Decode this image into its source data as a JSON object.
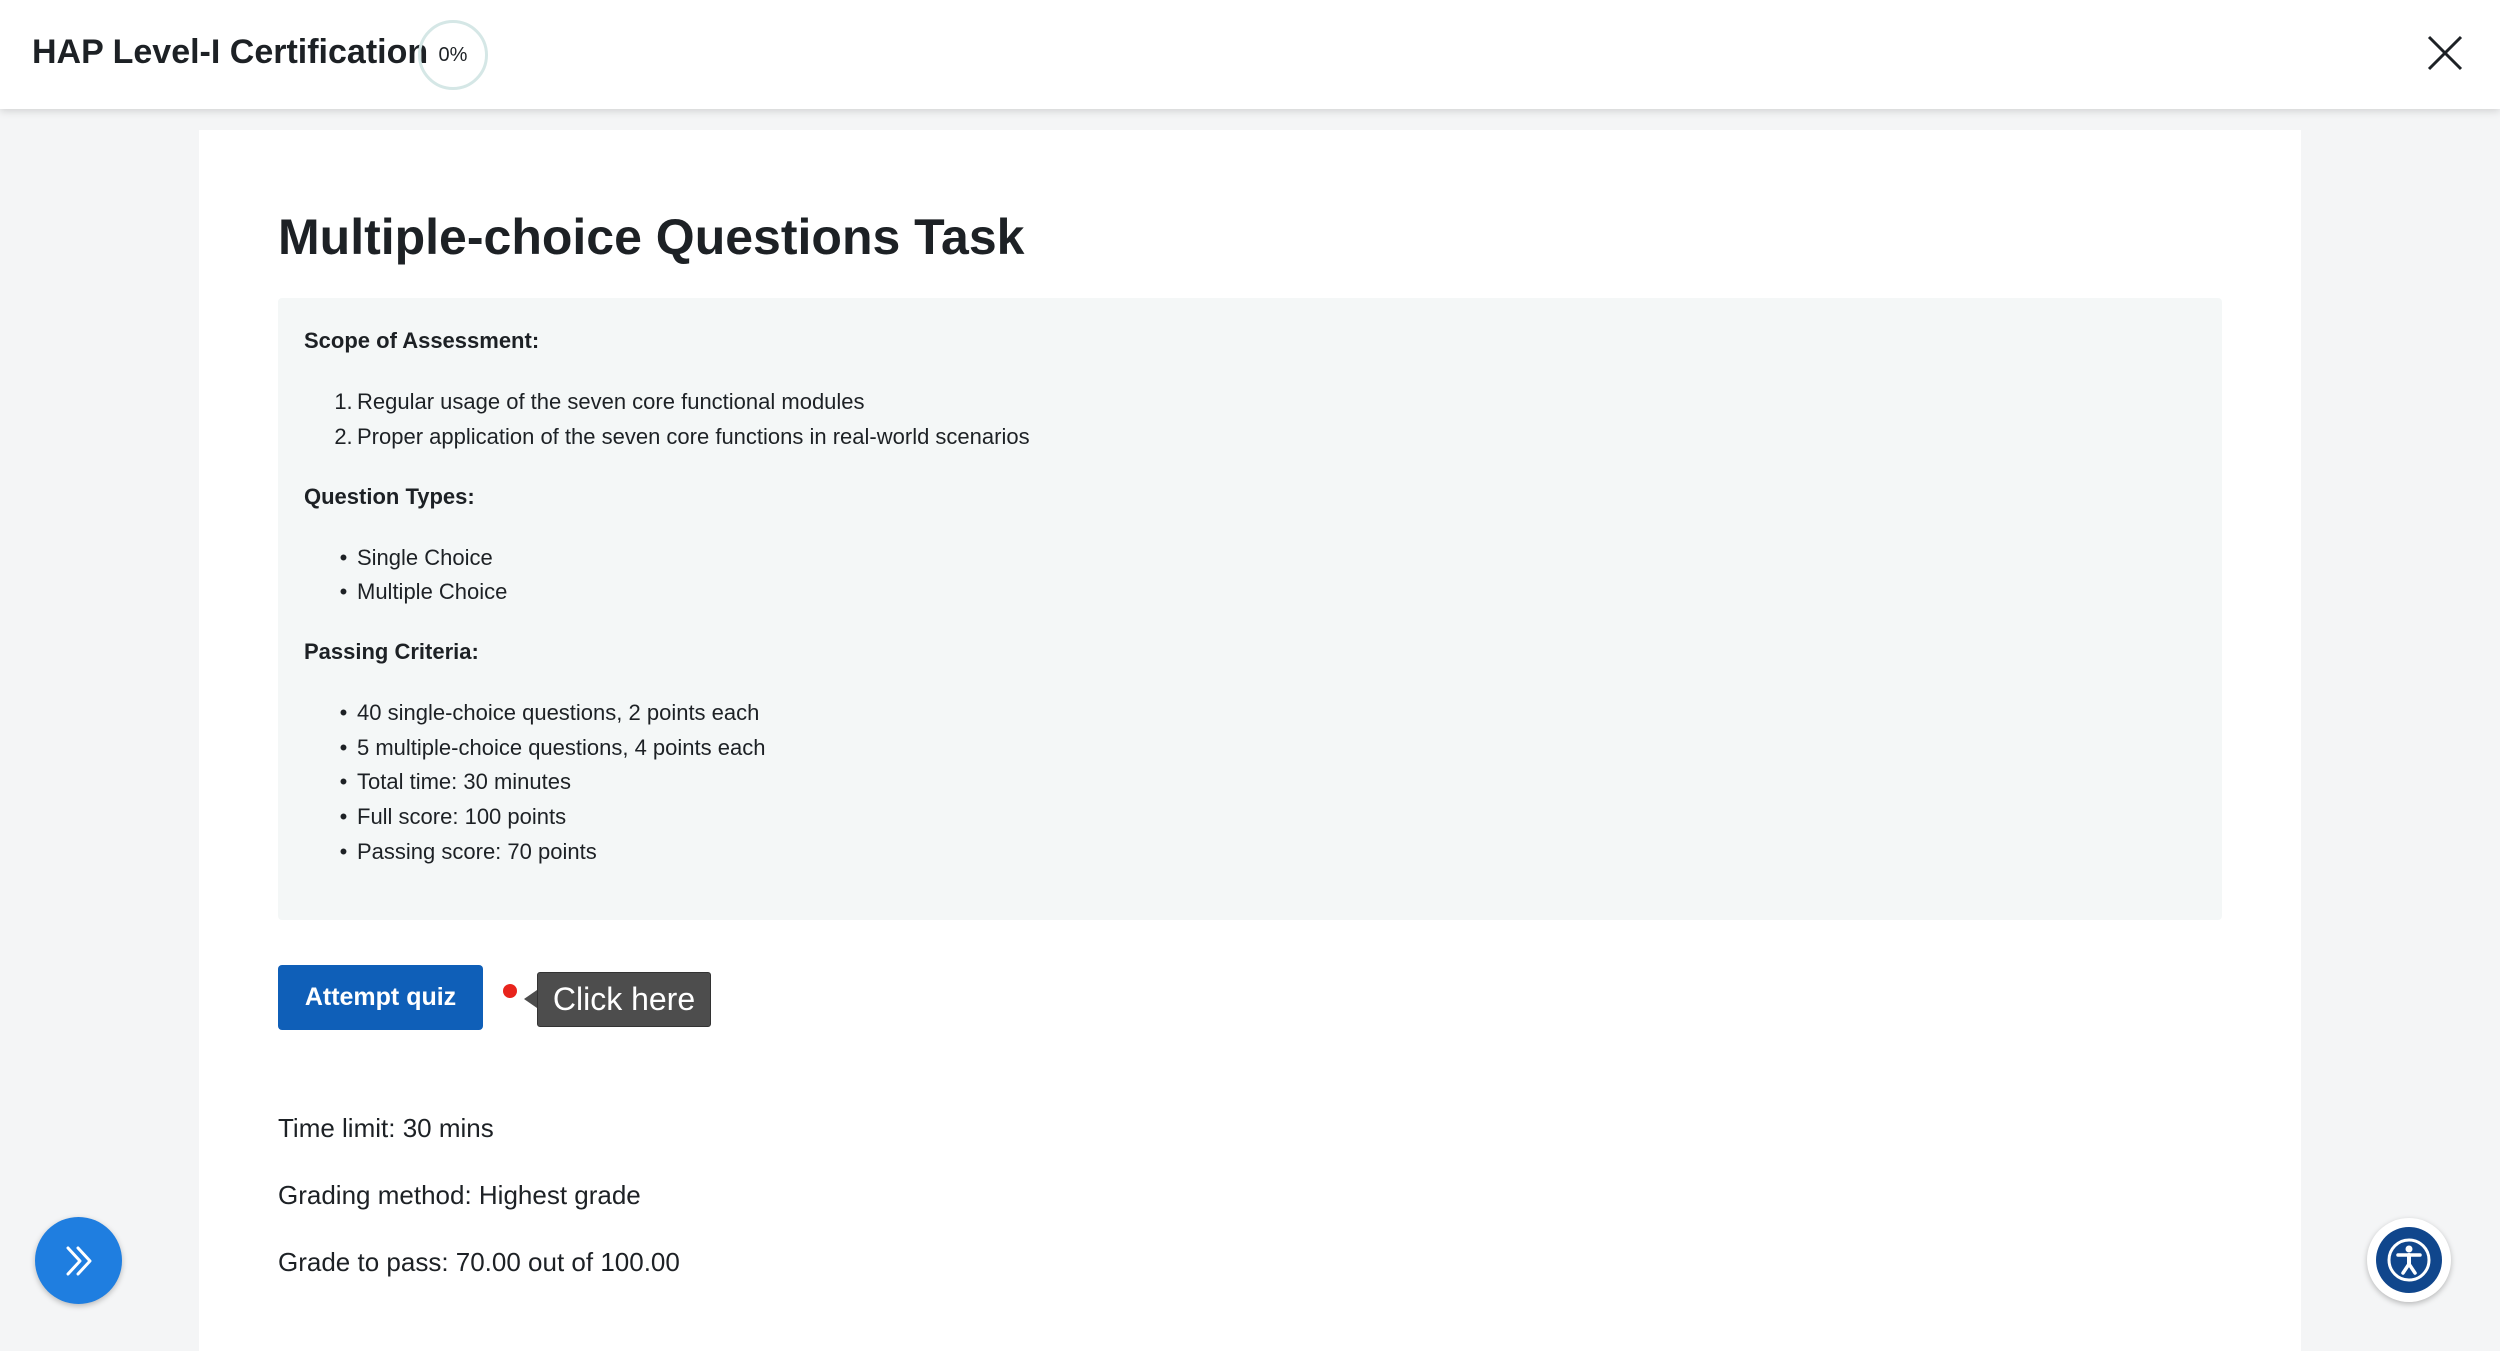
{
  "header": {
    "course_title": "HAP Level-I Certification",
    "progress_text": "0%",
    "close_icon": "close-icon"
  },
  "main": {
    "page_title": "Multiple-choice Questions Task",
    "description": {
      "scope_heading": "Scope of Assessment:",
      "scope_items": [
        "Regular usage of the seven core functional modules",
        "Proper application of the seven core functions in real-world scenarios"
      ],
      "types_heading": "Question Types:",
      "types_items": [
        "Single Choice",
        "Multiple Choice"
      ],
      "criteria_heading": "Passing Criteria:",
      "criteria_items": [
        "40 single-choice questions, 2 points each",
        "5 multiple-choice questions, 4 points each",
        "Total time: 30 minutes",
        "Full score: 100 points",
        "Passing score: 70 points"
      ]
    },
    "attempt_button": "Attempt quiz",
    "tooltip": "Click here",
    "time_limit": "Time limit: 30 mins",
    "grading_method": "Grading method: Highest grade",
    "grade_to_pass": "Grade to pass: 70.00 out of 100.00"
  },
  "floating": {
    "drawer_icon": "double-chevron-right-icon",
    "accessibility_icon": "accessibility-icon"
  },
  "colors": {
    "primary_button": "#0f5fb8",
    "drawer_button": "#1f7ee0",
    "accessibility": "#10468c",
    "tooltip_bg": "#4d4d4d",
    "indicator_dot": "#e8241c"
  }
}
